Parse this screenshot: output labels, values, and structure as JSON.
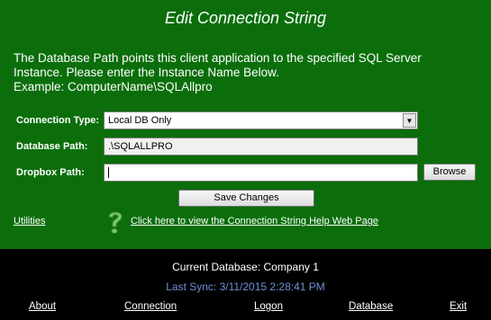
{
  "title": "Edit Connection String",
  "description": {
    "line1": "The Database Path points this client application to the specified SQL Server",
    "line2": "Instance.  Please enter the Instance Name Below.",
    "line3": "Example:  ComputerName\\SQLAllpro"
  },
  "form": {
    "connection_type_label": "Connection Type:",
    "connection_type_value": "Local DB Only",
    "database_path_label": "Database Path:",
    "database_path_value": ".\\SQLALLPRO",
    "dropbox_path_label": "Dropbox Path:",
    "dropbox_path_value": "",
    "browse_label": "Browse",
    "save_label": "Save Changes"
  },
  "links": {
    "utilities": "Utilities",
    "help": "Click here to view the Connection String Help Web Page"
  },
  "status": {
    "current_database": "Current Database: Company 1",
    "last_sync": "Last Sync: 3/11/2015 2:28:41 PM"
  },
  "footer_nav": {
    "about": "About",
    "connection": "Connection",
    "logon": "Logon",
    "database": "Database",
    "exit": "Exit"
  },
  "colors": {
    "panel_green": "#0b6e0b",
    "footer_black": "#000000",
    "sync_blue": "#6f8fd6",
    "help_icon_green": "#7bc96f"
  },
  "icons": {
    "help": "question-mark-icon",
    "dropdown": "chevron-down-icon"
  }
}
